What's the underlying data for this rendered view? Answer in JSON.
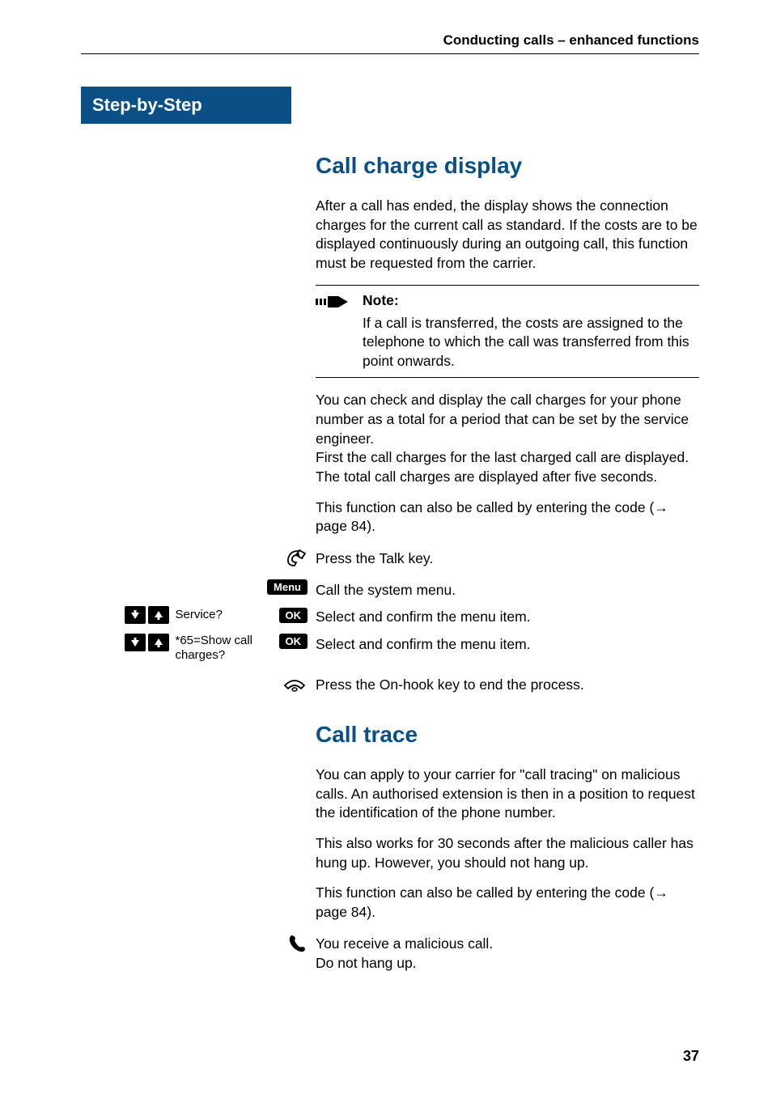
{
  "header": {
    "chapter": "Conducting calls – enhanced functions"
  },
  "sidebar": {
    "step_label": "Step-by-Step"
  },
  "section1": {
    "title": "Call charge display",
    "p1": "After a call has ended, the display shows the connection charges for the current call as standard. If the costs are to be displayed continuously during an outgoing call, this function must be requested from the carrier.",
    "note_label": "Note:",
    "note_text": "If a call is transferred, the costs are assigned to the telephone to which the call was transferred from this point onwards.",
    "p2a": "You can check and display the call charges for your phone number as a total for a period that can be set by the service engineer.",
    "p2b": "First the call charges for the last charged call are displayed. The total call charges are displayed after five seconds.",
    "p3": "This function can also be called by entering the code (",
    "p3_link": "page 84",
    "p3_end": ")."
  },
  "steps": {
    "talk": "Press the Talk key.",
    "menu_btn": "Menu",
    "menu_text": "Call the system menu.",
    "ok_btn": "OK",
    "service_label": "Service?",
    "service_text": "Select and confirm the menu item.",
    "show_charges_label": "*65=Show call charges?",
    "show_charges_text": "Select and confirm the menu item.",
    "onhook_text": "Press the On-hook key to end the process."
  },
  "section2": {
    "title": "Call trace",
    "p1": "You can apply to your carrier for \"call tracing\" on malicious calls. An authorised extension is then in a position to request the identification of the phone number.",
    "p2": "This also works for 30 seconds after the malicious caller has hung up. However, you should not hang up.",
    "p3": "This function can also be called by entering the code (",
    "p3_link": "page 84",
    "p3_end": ").",
    "malicious1": "You receive a malicious call.",
    "malicious2": "Do not hang up."
  },
  "page_number": "37"
}
